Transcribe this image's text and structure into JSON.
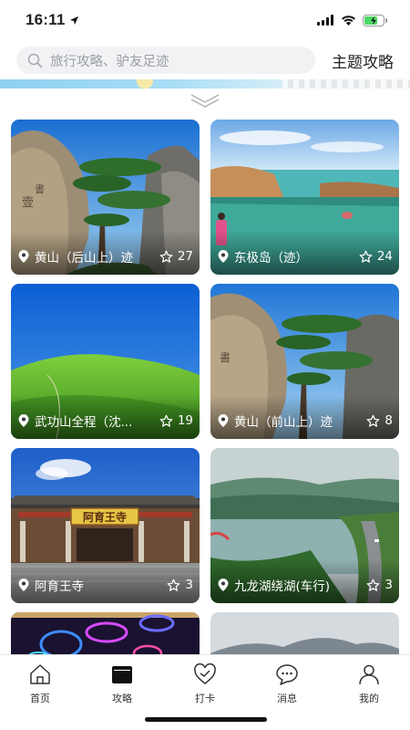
{
  "status_bar": {
    "time": "16:11"
  },
  "header": {
    "search_placeholder": "旅行攻略、驴友足迹",
    "theme_link": "主题攻略"
  },
  "cards": [
    {
      "title": "黄山（后山上）迹",
      "stars": "27"
    },
    {
      "title": "东极岛（迹）",
      "stars": "24"
    },
    {
      "title": "武功山全程（沈...",
      "stars": "19"
    },
    {
      "title": "黄山（前山上）迹",
      "stars": "8"
    },
    {
      "title": "阿育王寺",
      "stars": "3"
    },
    {
      "title": "九龙湖绕湖(车行)",
      "stars": "3"
    }
  ],
  "temple_sign": "阿育王寺",
  "tabs": [
    {
      "label": "首页"
    },
    {
      "label": "攻略"
    },
    {
      "label": "打卡"
    },
    {
      "label": "消息"
    },
    {
      "label": "我的"
    }
  ],
  "colors": {
    "accent": "#111111",
    "search_bg": "#f1f2f4",
    "placeholder": "#9a9da3"
  }
}
